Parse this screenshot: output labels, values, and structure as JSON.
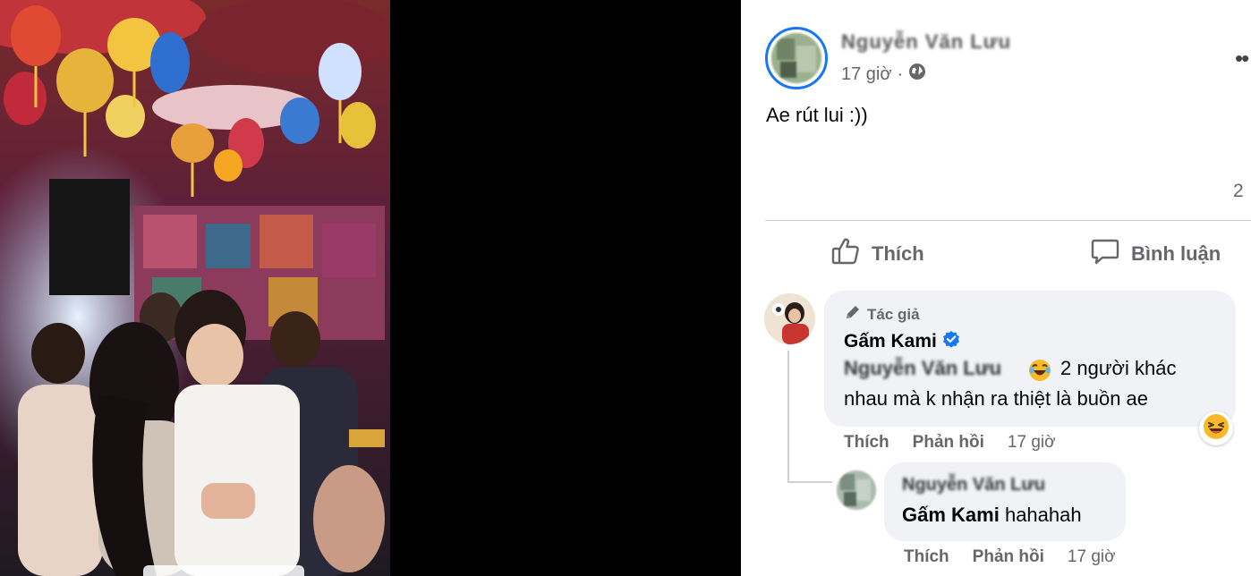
{
  "post": {
    "author_name": "Nguyễn Văn Lưu",
    "time": "17 giờ",
    "separator": "·",
    "audience_icon": "globe-icon",
    "text": "Ae rút lui :))",
    "reaction_count": "2",
    "more_icon": "more-horizontal-icon"
  },
  "actions": {
    "like_label": "Thích",
    "comment_label": "Bình luận"
  },
  "comments": [
    {
      "author_tag": "Tác giả",
      "name": "Gấm Kami",
      "verified_icon": "verified-badge-icon",
      "mention": "Nguyễn Văn Lưu",
      "text_line1": "2 người khác",
      "text_line2": "nhau mà k nhận ra thiệt là buồn ae",
      "reaction_icon": "laughing-face-icon",
      "like_label": "Thích",
      "reply_label": "Phản hồi",
      "time": "17 giờ"
    },
    {
      "name": "Nguyễn Văn Lưu",
      "mention": "Gấm Kami",
      "text": "hahahah",
      "like_label": "Thích",
      "reply_label": "Phản hồi",
      "time": "17 giờ"
    }
  ],
  "colors": {
    "accent": "#1877f2",
    "bubble": "#f0f2f5",
    "secondary_text": "#65676b"
  }
}
